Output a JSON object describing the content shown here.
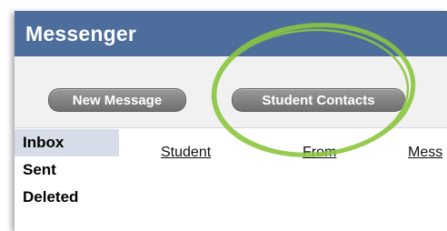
{
  "window": {
    "title": "Messenger"
  },
  "toolbar": {
    "new_message_label": "New Message",
    "student_contacts_label": "Student Contacts"
  },
  "sidebar": {
    "items": [
      {
        "label": "Inbox",
        "active": true
      },
      {
        "label": "Sent"
      },
      {
        "label": "Deleted"
      }
    ]
  },
  "table": {
    "columns": [
      "Student",
      "From",
      "Mess"
    ]
  },
  "colors": {
    "titlebar": "#4d6e9c",
    "active_item": "#d6dde8",
    "highlight_circle": "#8cc63f"
  }
}
